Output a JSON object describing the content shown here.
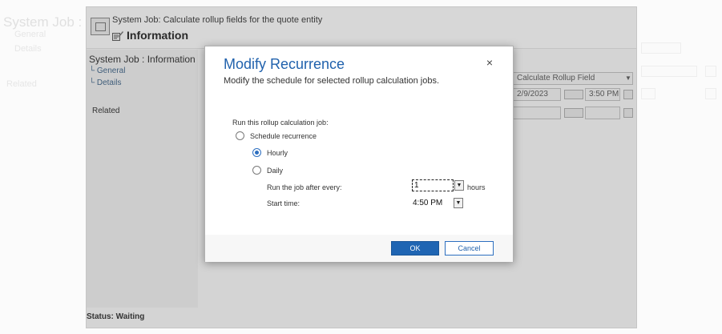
{
  "background_page": {
    "title": "System Job : Inf",
    "links": [
      "General",
      "Details"
    ],
    "related": "Related"
  },
  "inner_window": {
    "header": {
      "title": "System Job: Calculate rollup fields for the quote entity",
      "subtitle": "Information"
    },
    "sidebar": {
      "title": "System Job : Information",
      "links": [
        "General",
        "Details"
      ],
      "related": "Related"
    },
    "fields": {
      "system_job_type": "Calculate Rollup Field",
      "date_value": "2/9/2023",
      "time_value": "3:50 PM"
    },
    "status": "Status: Waiting"
  },
  "modal": {
    "title": "Modify Recurrence",
    "subtitle": "Modify the schedule for selected rollup calculation jobs.",
    "close_label": "×",
    "run_label": "Run this rollup calculation job:",
    "options": {
      "schedule_recurrence": "Schedule recurrence",
      "hourly": "Hourly",
      "daily": "Daily"
    },
    "run_every_label": "Run the job after every:",
    "run_every_value": "1",
    "run_every_unit": "hours",
    "start_time_label": "Start time:",
    "start_time_value": "4:50 PM",
    "ok_label": "OK",
    "cancel_label": "Cancel",
    "selected_option": "hourly",
    "accent_color": "#2162ad"
  }
}
